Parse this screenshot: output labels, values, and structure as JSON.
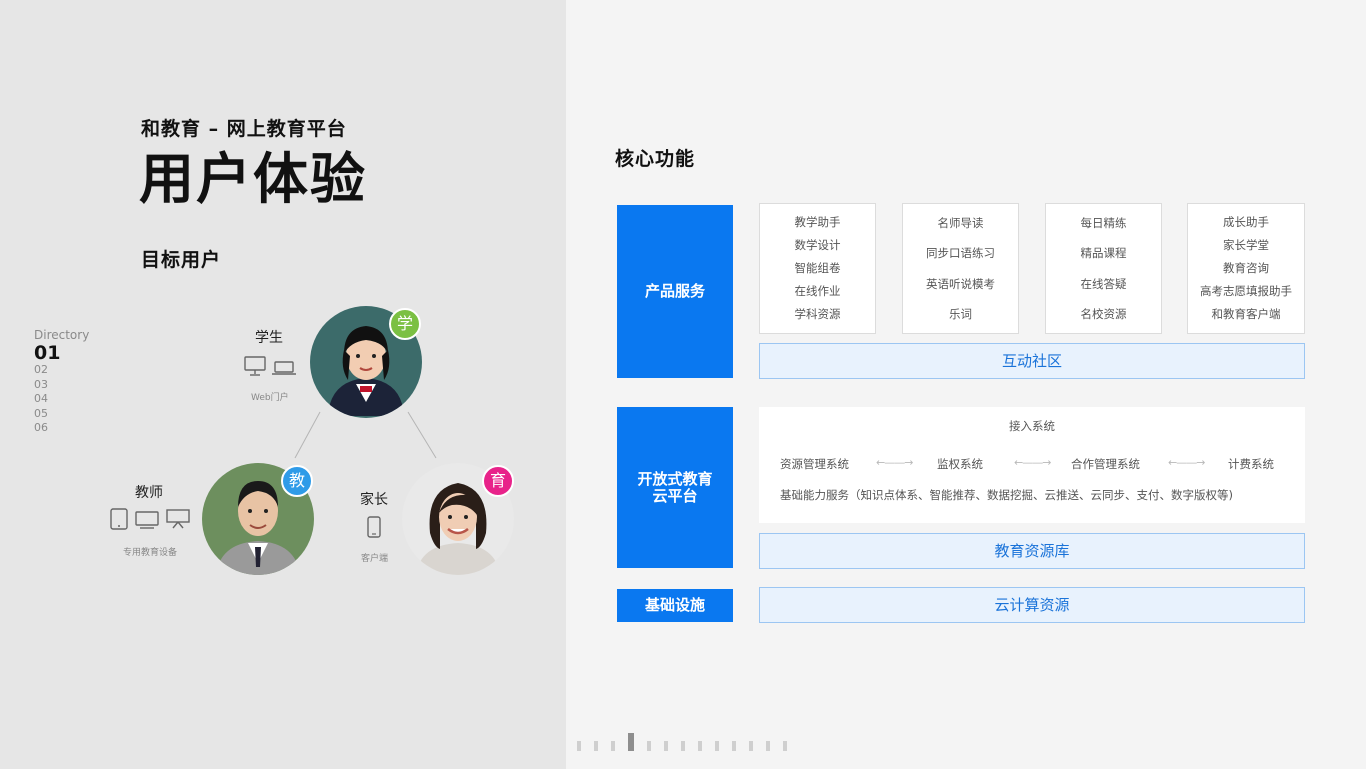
{
  "header": {
    "subtitle": "和教育 – 网上教育平台",
    "title": "用户体验",
    "section": "目标用户"
  },
  "directory": {
    "label": "Directory",
    "items": [
      "01",
      "02",
      "03",
      "04",
      "05",
      "06"
    ],
    "active_index": 0
  },
  "users": {
    "student": {
      "label": "学生",
      "badge": "学",
      "badge_color": "#7bc043",
      "device_caption": "Web门户",
      "devices": [
        "desktop-icon",
        "laptop-icon"
      ]
    },
    "teacher": {
      "label": "教师",
      "badge": "教",
      "badge_color": "#2f9be8",
      "device_caption": "专用教育设备",
      "devices": [
        "tablet-icon",
        "monitor-icon",
        "projector-icon"
      ]
    },
    "parent": {
      "label": "家长",
      "badge": "育",
      "badge_color": "#e8238a",
      "device_caption": "客户端",
      "devices": [
        "phone-icon"
      ]
    }
  },
  "core": {
    "title": "核心功能",
    "product_service": {
      "label": "产品服务",
      "cards": [
        [
          "教学助手",
          "数学设计",
          "智能组卷",
          "在线作业",
          "学科资源"
        ],
        [
          "名师导读",
          "同步口语练习",
          "英语听说模考",
          "乐词"
        ],
        [
          "每日精练",
          "精品课程",
          "在线答疑",
          "名校资源"
        ],
        [
          "成长助手",
          "家长学堂",
          "教育咨询",
          "高考志愿填报助手",
          "和教育客户端"
        ]
      ],
      "community": "互动社区"
    },
    "platform": {
      "label_line1": "开放式教育",
      "label_line2": "云平台",
      "access": "接入系统",
      "systems": [
        "资源管理系统",
        "监权系统",
        "合作管理系统",
        "计费系统"
      ],
      "basic": "基础能力服务（知识点体系、智能推荐、数据挖掘、云推送、云同步、支付、数字版权等)",
      "library": "教育资源库"
    },
    "infra": {
      "label": "基础设施",
      "cloud": "云计算资源"
    },
    "accent_color": "#0a78f0"
  },
  "pager": {
    "count": 13,
    "active_index": 3
  }
}
